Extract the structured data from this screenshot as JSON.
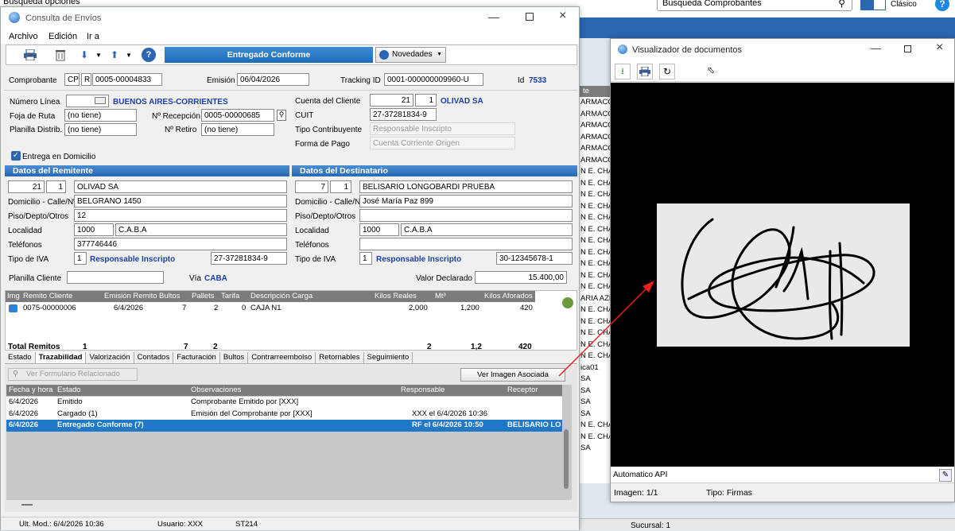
{
  "top": {
    "busqueda_opciones": "Busqueda opciones",
    "busqueda_comprobantes": "Busqueda Comprobantes",
    "clasico": "Clásico"
  },
  "main": {
    "title": "Consulta de Envíos",
    "menu": [
      "Archivo",
      "Edición",
      "Ir a"
    ],
    "status_banner": "Entregado Conforme",
    "novedades": "Novedades",
    "comprobante_label": "Comprobante",
    "comprobante_cp": "CP",
    "comprobante_letra": "R",
    "comprobante_num": "0005-00004833",
    "emision_label": "Emisión",
    "emision": "06/04/2026",
    "tracking_label": "Tracking ID",
    "tracking": "0001-000000009960-U",
    "id_label": "Id",
    "id": "7533",
    "numero_linea_label": "Número Línea",
    "numero_linea": "BUENOS AIRES-CORRIENTES",
    "foja_label": "Foja de Ruta",
    "foja": "(no tiene)",
    "recepcion_label": "Nº Recepción",
    "recepcion": "0005-00000685",
    "planilla_label": "Planilla Distrib.",
    "planilla": "(no tiene)",
    "retiro_label": "Nº Retiro",
    "retiro": "(no tiene)",
    "cuenta_label": "Cuenta del Cliente",
    "cuenta_num": "21",
    "cuenta_sub": "1",
    "cuenta_name": "OLIVAD SA",
    "cuit_label": "CUIT",
    "cuit": "27-37281834-9",
    "tipo_contrib_label": "Tipo Contribuyente",
    "tipo_contrib": "Responsable Inscripto",
    "forma_pago_label": "Forma de Pago",
    "forma_pago": "Cuenta Corriente Origen",
    "entrega_domicilio": "Entrega en Domicilio",
    "remitente": {
      "header": "Datos del Remitente",
      "num": "21",
      "sub": "1",
      "name": "OLIVAD SA",
      "domicilio_label": "Domicilio - Calle/Nº",
      "domicilio": "BELGRANO 1450",
      "piso_label": "Piso/Depto/Otros",
      "piso": "12",
      "localidad_label": "Localidad",
      "cp": "1000",
      "localidad": "C.A.B.A",
      "tel_label": "Teléfonos",
      "tel": "377746446",
      "iva_label": "Tipo de IVA",
      "iva_code": "1",
      "iva": "Responsable Inscripto",
      "cuit": "27-37281834-9"
    },
    "destinatario": {
      "header": "Datos del Destinatario",
      "num": "7",
      "sub": "1",
      "name": "BELISARIO LONGOBARDI PRUEBA",
      "domicilio_label": "Domicilio - Calle/Nº",
      "domicilio": "José María Paz 899",
      "piso_label": "Piso/Depto/Otros",
      "piso": "",
      "localidad_label": "Localidad",
      "cp": "1000",
      "localidad": "C.A.B.A",
      "tel_label": "Teléfonos",
      "tel": "",
      "iva_label": "Tipo de IVA",
      "iva_code": "1",
      "iva": "Responsable Inscripto",
      "cuit": "30-12345678-1"
    },
    "planilla_cliente_label": "Planilla Cliente",
    "via_label": "Vía",
    "via": "CABA",
    "valor_label": "Valor Declarado",
    "valor": "15.400,00",
    "remitos_headers": [
      "Img",
      "Remito Cliente",
      "Emisión Remito",
      "Bultos",
      "Pallets",
      "Tarifa",
      "Descripción Carga",
      "Kilos Reales",
      "Mt³",
      "Kilos Aforados"
    ],
    "remitos_row": [
      "0075-00000006",
      "6/4/2026",
      "7",
      "2",
      "0",
      "CAJA N1",
      "2,000",
      "1,200",
      "420"
    ],
    "totals": [
      "Total Remitos",
      "1",
      "7",
      "2",
      "2",
      "1,2",
      "420"
    ],
    "tabs": [
      "Estado",
      "Trazabilidad",
      "Valorización",
      "Contados",
      "Facturación",
      "Bultos",
      "Contrarreembolso",
      "Retornables",
      "Seguimiento"
    ],
    "ver_formulario": "Ver Formulario Relacionado",
    "ver_imagen": "Ver Imagen Asociada",
    "traz_headers": [
      "Fecha y hora",
      "Estado",
      "Observaciones",
      "Responsable",
      "Receptor"
    ],
    "traz_rows": [
      [
        "6/4/2026",
        "Emitido",
        "Comprobante Emitido por [XXX]",
        "",
        ""
      ],
      [
        "6/4/2026",
        "Cargado (1)",
        "Emisión del Comprobante por [XXX]",
        "XXX el 6/4/2026 10:36",
        ""
      ],
      [
        "6/4/2026",
        "Entregado Conforme (7)",
        "",
        "RF el 6/4/2026 10:50",
        "BELISARIO LO"
      ]
    ],
    "status_bar": {
      "ult_mod": "Ult. Mod.: 6/4/2026 10:36",
      "usuario": "Usuario: XXX",
      "st": "ST214"
    }
  },
  "background_list": [
    "ARMACC",
    "ARMACC",
    "ARMACC",
    "ARMACC",
    "ARMACC",
    "ARMACC",
    "N E. CHA",
    "N E. CHA",
    "N E. CHA",
    "N E. CHA",
    "N E. CHA",
    "N E. CHA",
    "N E. CHA",
    "N E. CHA",
    "N E. CHA",
    "N E. CHA",
    "N E. CHA",
    "ARIA AZN",
    "N E. CHA",
    "N E. CHA",
    "N E. CHA",
    "N E. CHA",
    "N E. CHA",
    "ica01",
    "SA",
    "SA",
    "SA",
    "SA",
    "N E. CHA",
    "N E. CHA",
    "SA"
  ],
  "background_header": "te",
  "bg_status": "Sucursal: 1",
  "viewer": {
    "title": "Visualizador de documentos",
    "auto_api": "Automatico API",
    "imagen": "Imagen: 1/1",
    "tipo": "Tipo: Firmas"
  }
}
